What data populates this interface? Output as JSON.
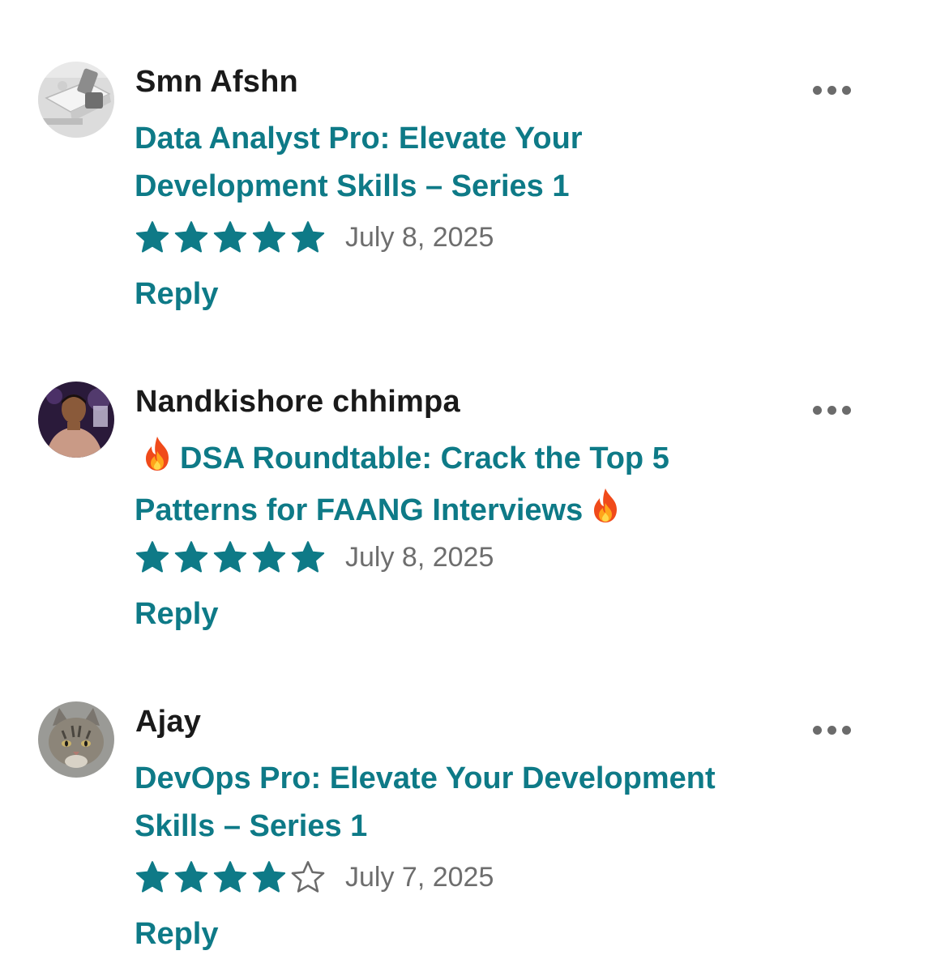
{
  "reviews": [
    {
      "reviewer_name": "Smn Afshn",
      "avatar_icon": "laptop-photo-avatar",
      "event_title": "Data Analyst Pro: Elevate Your Development Skills – Series 1",
      "rating": 5,
      "max_rating": 5,
      "date": "July 8, 2025",
      "reply_label": "Reply"
    },
    {
      "reviewer_name": "Nandkishore chhimpa",
      "avatar_icon": "person-photo-avatar",
      "event_title_parts": [
        "🔥",
        "DSA Roundtable: Crack the Top 5 Patterns for FAANG Interviews",
        "🔥"
      ],
      "rating": 5,
      "max_rating": 5,
      "date": "July 8, 2025",
      "reply_label": "Reply"
    },
    {
      "reviewer_name": "Ajay",
      "avatar_icon": "cat-photo-avatar",
      "event_title": "DevOps Pro: Elevate Your Development Skills – Series 1",
      "rating": 4,
      "max_rating": 5,
      "date": "July 7, 2025",
      "reply_label": "Reply"
    }
  ],
  "colors": {
    "accent": "#0e7a87",
    "name_text": "#1a1a1a",
    "date_text": "#6e6e6e",
    "more_dots": "#6b6b6b",
    "star_filled": "#0e7a87",
    "star_empty_outline": "#6b6b6b"
  },
  "icons": {
    "more": "more-horizontal-icon",
    "star_filled": "star-filled-icon",
    "star_empty": "star-outline-icon",
    "fire": "fire-emoji-icon"
  }
}
